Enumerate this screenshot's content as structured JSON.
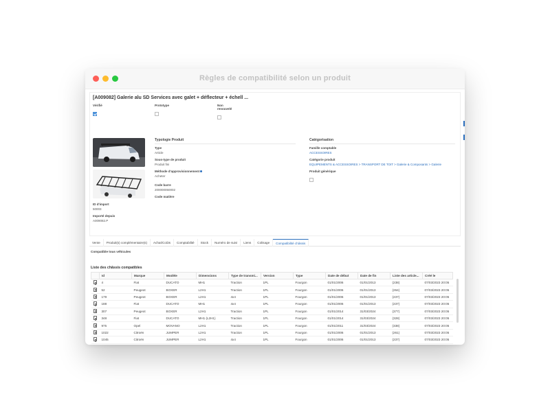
{
  "window": {
    "title": "Règles de compatibilité selon un produit"
  },
  "product": {
    "title": "[A009082] Galerie alu SD Services avec galet + déflecteur + échell ...",
    "flags": [
      {
        "label": "Vérifié",
        "checked": true
      },
      {
        "label": "Prototype",
        "checked": false
      },
      {
        "label": "Non renouvelé",
        "checked": false
      }
    ],
    "import_id_label": "ID d'import",
    "import_id_value": "50003",
    "imported_from_label": "Importé depuis",
    "imported_from_value": "A009082.P"
  },
  "typologie": {
    "section_title": "Typologie Produit",
    "type_label": "Type",
    "type_value": "Article",
    "subtype_label": "Sous-type de produit",
    "subtype_value": "Produit fini",
    "method_label": "Méthode d'approvisionnement",
    "method_value": "Acheter",
    "barcode_label": "Code barre",
    "barcode_value": "200000050002",
    "material_label": "Code matière"
  },
  "categorisation": {
    "section_title": "Catégorisation",
    "family_label": "Famille comptable",
    "family_value": "ACCESSOIRES",
    "category_label": "Catégorie produit",
    "category_value": "EQUIPEMENTS & ACCESSOIRES > TRANSPORT DE TOIT > Galerie & Composants > Galerie",
    "generic_label": "Produit générique"
  },
  "tabs": [
    {
      "label": "Vente",
      "active": false
    },
    {
      "label": "Produit(s) complémentaire(s)",
      "active": false
    },
    {
      "label": "Achat/Coûts",
      "active": false
    },
    {
      "label": "Comptabilité",
      "active": false
    },
    {
      "label": "Stock",
      "active": false
    },
    {
      "label": "Numéro de suivi",
      "active": false
    },
    {
      "label": "Liens",
      "active": false
    },
    {
      "label": "Colisage",
      "active": false
    },
    {
      "label": "Compatibilité châssis",
      "active": true
    }
  ],
  "compat_all_label": "Compatible tous véhicules",
  "list_title": "Liste des châssis compatibles",
  "table": {
    "columns": [
      "Id",
      "Marque",
      "Modèle",
      "Dimensions",
      "Type de transmi...",
      "Version",
      "Type",
      "Date de début",
      "Date de fin",
      "Liste des article...",
      "Créé le"
    ],
    "rows": [
      [
        "4",
        "Fiat",
        "DUCATO",
        "MH1",
        "Traction",
        "1PL",
        "Fourgon",
        "01/01/2006",
        "01/01/2013",
        "(238)",
        "07/03/2023 20:05"
      ],
      [
        "52",
        "Peugeot",
        "BOXER",
        "L2H1",
        "Traction",
        "1PL",
        "Fourgon",
        "01/01/2006",
        "01/01/2013",
        "(264)",
        "07/03/2023 20:05"
      ],
      [
        "179",
        "Peugeot",
        "BOXER",
        "L2H1",
        "4x4",
        "1PL",
        "Fourgon",
        "01/01/2006",
        "01/01/2013",
        "(237)",
        "07/03/2023 20:05"
      ],
      [
        "188",
        "Fiat",
        "DUCATO",
        "MH1",
        "4x4",
        "1PL",
        "Fourgon",
        "01/01/2006",
        "01/01/2013",
        "(237)",
        "07/03/2023 20:05"
      ],
      [
        "307",
        "Peugeot",
        "BOXER",
        "L2H1",
        "Traction",
        "1PL",
        "Fourgon",
        "01/01/2014",
        "31/03/2024",
        "(377)",
        "07/03/2023 20:05"
      ],
      [
        "348",
        "Fiat",
        "DUCATO",
        "MH1 (L2H1)",
        "Traction",
        "1PL",
        "Fourgon",
        "01/01/2014",
        "31/03/2024",
        "(328)",
        "07/03/2023 20:05"
      ],
      [
        "975",
        "Opel",
        "MOVANO",
        "L2H1",
        "Traction",
        "1PL",
        "Fourgon",
        "01/01/2011",
        "31/03/2024",
        "(338)",
        "07/03/2023 20:05"
      ],
      [
        "1022",
        "Citroën",
        "JUMPER",
        "L2H1",
        "Traction",
        "1PL",
        "Fourgon",
        "01/01/2006",
        "01/01/2013",
        "(261)",
        "07/03/2023 20:05"
      ],
      [
        "1045",
        "Citroën",
        "JUMPER",
        "L2H1",
        "4x4",
        "1PL",
        "Fourgon",
        "01/01/2006",
        "01/01/2013",
        "(237)",
        "07/03/2023 20:05"
      ]
    ]
  },
  "colors": {
    "accent": "#2a6ebd",
    "close": "#fe5f57",
    "minimize": "#febc2e",
    "maximize": "#28c840"
  }
}
